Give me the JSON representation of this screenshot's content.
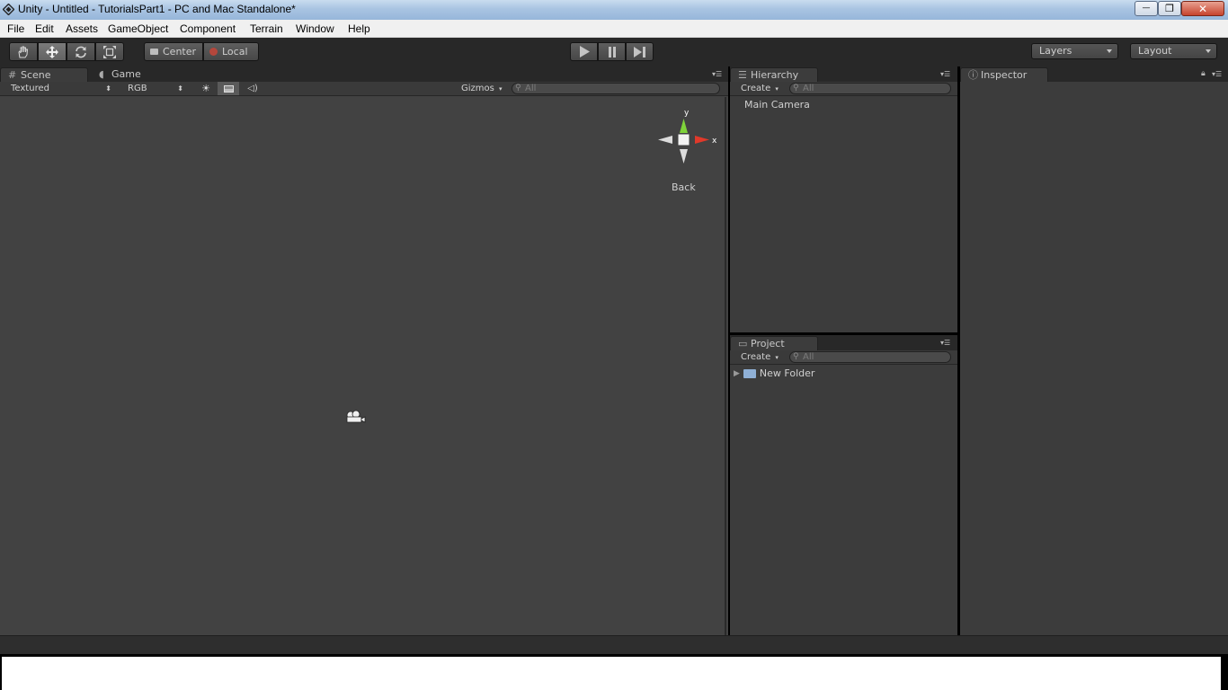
{
  "window": {
    "title": "Unity - Untitled - TutorialsPart1 - PC and Mac Standalone*",
    "controls": {
      "minimize": "—",
      "maximize": "❐",
      "close": "✕"
    }
  },
  "menu": [
    "File",
    "Edit",
    "Assets",
    "GameObject",
    "Component",
    "Terrain",
    "Window",
    "Help"
  ],
  "toolbar": {
    "tools": [
      "hand-icon",
      "move-icon",
      "rotate-icon",
      "scale-icon"
    ],
    "pivot_center": "Center",
    "pivot_local": "Local",
    "layers": "Layers",
    "layout": "Layout"
  },
  "scene": {
    "tab_scene": "Scene",
    "tab_game": "Game",
    "render_mode": "Textured",
    "color_mode": "RGB",
    "gizmos": "Gizmos",
    "search_placeholder": "All",
    "gizmo_view": "Back",
    "axis_y": "y",
    "axis_x": "x"
  },
  "hierarchy": {
    "tab": "Hierarchy",
    "create": "Create",
    "search_placeholder": "All",
    "items": [
      "Main Camera"
    ]
  },
  "project": {
    "tab": "Project",
    "create": "Create",
    "search_placeholder": "All",
    "items": [
      "New Folder"
    ]
  },
  "inspector": {
    "tab": "Inspector"
  },
  "colors": {
    "panel_bg": "#3c3c3c",
    "scene_bg": "#424242",
    "gizmo_y": "#7fd33a",
    "gizmo_x": "#e0392a"
  }
}
